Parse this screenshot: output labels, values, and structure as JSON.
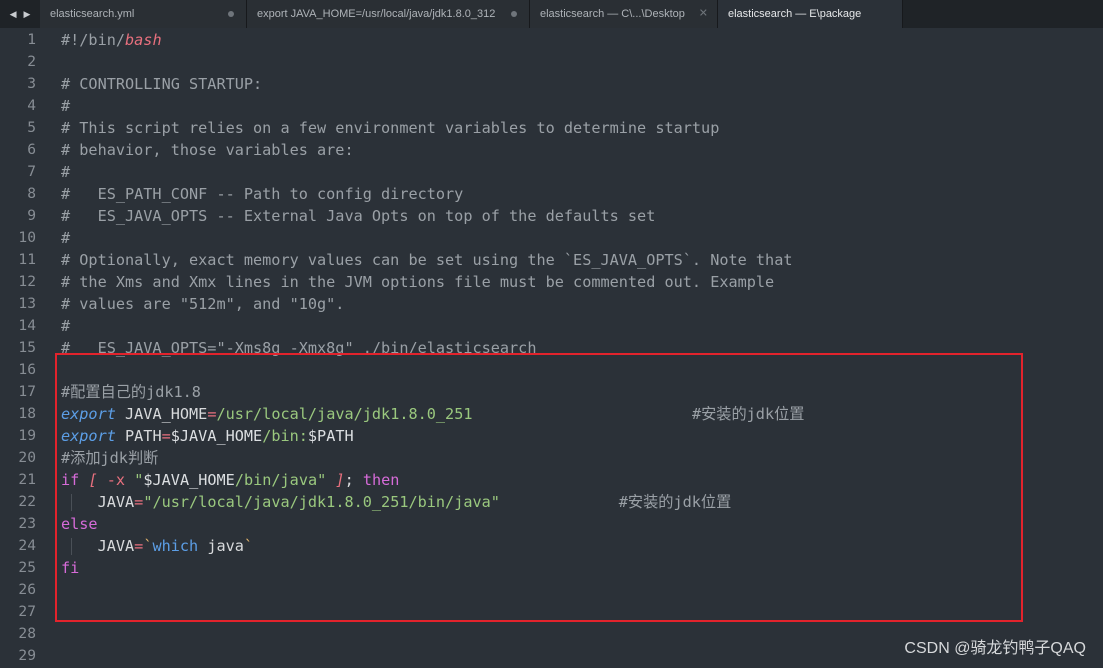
{
  "tabs": [
    {
      "label": "elasticsearch.yml",
      "state": "modified"
    },
    {
      "label": "export JAVA_HOME=/usr/local/java/jdk1.8.0_312",
      "state": "modified"
    },
    {
      "label": "elasticsearch — C\\...\\Desktop",
      "state": "closable"
    },
    {
      "label": "elasticsearch — E\\package",
      "state": "active"
    }
  ],
  "nav": {
    "back": "◀",
    "forward": "▶"
  },
  "editor": {
    "lines": [
      {
        "n": "1",
        "parts": [
          [
            "c",
            "#!/bin/"
          ],
          [
            "itred",
            "bash"
          ]
        ]
      },
      {
        "n": "2",
        "parts": []
      },
      {
        "n": "3",
        "parts": [
          [
            "c",
            "# CONTROLLING STARTUP:"
          ]
        ]
      },
      {
        "n": "4",
        "parts": [
          [
            "c",
            "#"
          ]
        ]
      },
      {
        "n": "5",
        "parts": [
          [
            "c",
            "# This script relies on a few environment variables to determine startup"
          ]
        ]
      },
      {
        "n": "6",
        "parts": [
          [
            "c",
            "# behavior, those variables are:"
          ]
        ]
      },
      {
        "n": "7",
        "parts": [
          [
            "c",
            "#"
          ]
        ]
      },
      {
        "n": "8",
        "parts": [
          [
            "c",
            "#   ES_PATH_CONF -- Path to config directory"
          ]
        ]
      },
      {
        "n": "9",
        "parts": [
          [
            "c",
            "#   ES_JAVA_OPTS -- External Java Opts on top of the defaults set"
          ]
        ]
      },
      {
        "n": "10",
        "parts": [
          [
            "c",
            "#"
          ]
        ]
      },
      {
        "n": "11",
        "parts": [
          [
            "c",
            "# Optionally, exact memory values can be set using the `ES_JAVA_OPTS`. Note that"
          ]
        ]
      },
      {
        "n": "12",
        "parts": [
          [
            "c",
            "# the Xms and Xmx lines in the JVM options file must be commented out. Example"
          ]
        ]
      },
      {
        "n": "13",
        "parts": [
          [
            "c",
            "# values are \"512m\", and \"10g\"."
          ]
        ]
      },
      {
        "n": "14",
        "parts": [
          [
            "c",
            "#"
          ]
        ]
      },
      {
        "n": "15",
        "parts": [
          [
            "c",
            "#   ES_JAVA_OPTS=\"-Xms8g -Xmx8g\" ./bin/elasticsearch"
          ]
        ]
      },
      {
        "n": "16",
        "parts": []
      },
      {
        "n": "17",
        "parts": [
          [
            "c",
            "#配置自己的jdk1.8"
          ]
        ]
      },
      {
        "n": "18",
        "parts": [
          [
            "kw",
            "export"
          ],
          [
            "plain",
            " JAVA_HOME"
          ],
          [
            "op",
            "="
          ],
          [
            "str",
            "/usr/local/java/jdk1.8.0_251"
          ],
          [
            "c",
            "                        #安装的jdk位置"
          ]
        ]
      },
      {
        "n": "19",
        "parts": [
          [
            "kw",
            "export"
          ],
          [
            "plain",
            " PATH"
          ],
          [
            "op",
            "="
          ],
          [
            "var",
            "$JAVA_HOME"
          ],
          [
            "str",
            "/bin:"
          ],
          [
            "var",
            "$PATH"
          ]
        ]
      },
      {
        "n": "20",
        "parts": [
          [
            "c",
            "#添加jdk判断"
          ]
        ]
      },
      {
        "n": "21",
        "parts": [
          [
            "kp",
            "if"
          ],
          [
            "plain",
            " "
          ],
          [
            "itred",
            "["
          ],
          [
            "plain",
            " "
          ],
          [
            "flag",
            "-x"
          ],
          [
            "plain",
            " "
          ],
          [
            "str",
            "\""
          ],
          [
            "var",
            "$JAVA_HOME"
          ],
          [
            "str",
            "/bin/java\""
          ],
          [
            "plain",
            " "
          ],
          [
            "itred",
            "]"
          ],
          [
            "plain",
            "; "
          ],
          [
            "kp",
            "then"
          ]
        ]
      },
      {
        "n": "22",
        "indent": true,
        "parts": [
          [
            "plain",
            "    JAVA"
          ],
          [
            "op",
            "="
          ],
          [
            "str",
            "\"/usr/local/java/jdk1.8.0_251/bin/java\""
          ],
          [
            "c",
            "             #安装的jdk位置"
          ]
        ]
      },
      {
        "n": "23",
        "parts": [
          [
            "kp",
            "else"
          ]
        ]
      },
      {
        "n": "24",
        "indent": true,
        "parts": [
          [
            "plain",
            "    JAVA"
          ],
          [
            "op",
            "="
          ],
          [
            "bt",
            "`"
          ],
          [
            "cmdfn",
            "which"
          ],
          [
            "plain",
            " java"
          ],
          [
            "bt",
            "`"
          ]
        ]
      },
      {
        "n": "25",
        "parts": [
          [
            "kp",
            "fi"
          ]
        ]
      },
      {
        "n": "26",
        "parts": []
      },
      {
        "n": "27",
        "parts": []
      },
      {
        "n": "28",
        "parts": []
      },
      {
        "n": "29",
        "parts": []
      }
    ]
  },
  "watermark": "CSDN @骑龙钓鸭子QAQ"
}
